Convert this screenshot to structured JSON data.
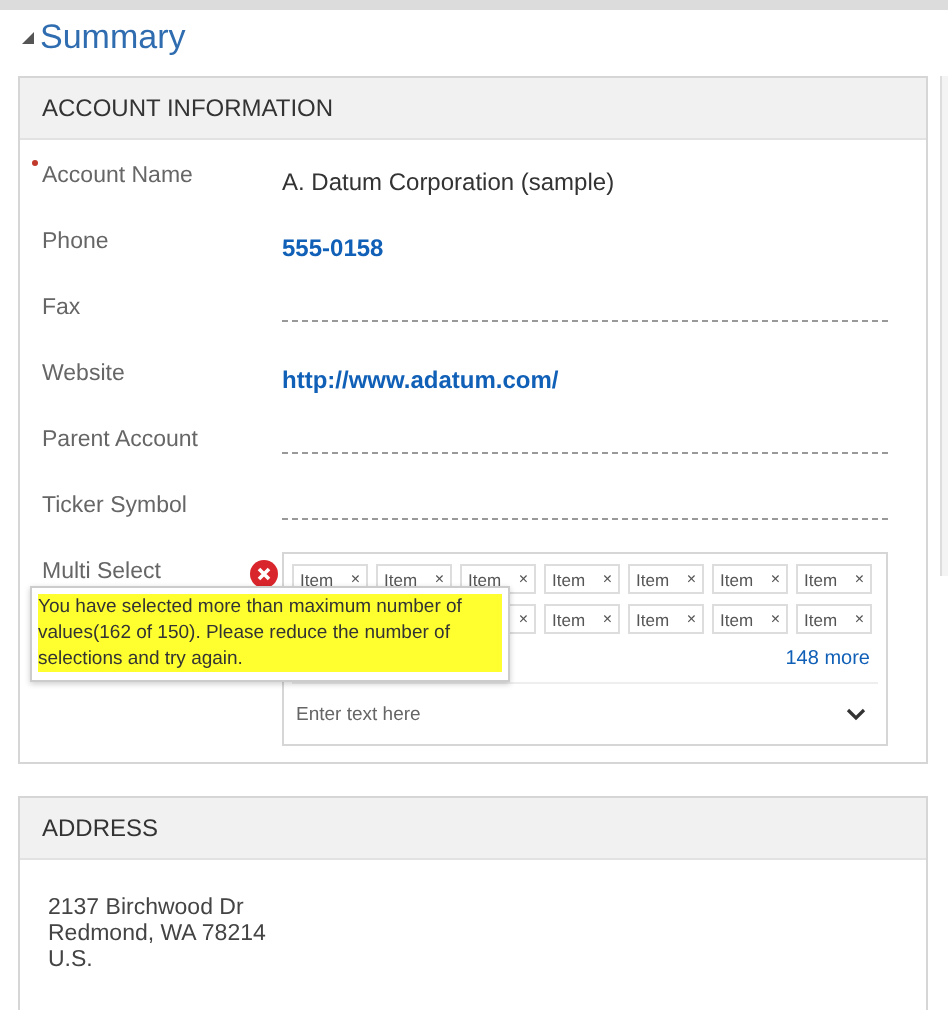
{
  "summary": {
    "title": "Summary",
    "expanded": true
  },
  "account_information": {
    "title": "ACCOUNT INFORMATION",
    "fields": [
      {
        "kind": "text",
        "label": "Account Name",
        "required": true,
        "value": "A. Datum Corporation (sample)"
      },
      {
        "kind": "link",
        "label": "Phone",
        "required": false,
        "value": "555-0158"
      },
      {
        "kind": "empty",
        "label": "Fax",
        "required": false
      },
      {
        "kind": "link",
        "label": "Website",
        "required": false,
        "value": "http://www.adatum.com/"
      },
      {
        "kind": "empty",
        "label": "Parent Account",
        "required": false
      },
      {
        "kind": "empty",
        "label": "Ticker Symbol",
        "required": false
      },
      {
        "kind": "multiselect",
        "label": "Multi Select",
        "required": false,
        "error": true,
        "token_rows": [
          [
            {
              "label": "Item"
            },
            {
              "label": "Item"
            },
            {
              "label": "Item"
            },
            {
              "label": "Item"
            },
            {
              "label": "Item"
            },
            {
              "label": "Item"
            },
            {
              "label": "Item"
            }
          ],
          [
            {
              "partly_hidden": true
            },
            {
              "label": "Item"
            },
            {
              "label": "Item"
            },
            {
              "label": "Item"
            },
            {
              "label": "Item"
            }
          ]
        ],
        "remove_glyph": "×",
        "more": "148 more",
        "placeholder": "Enter text here",
        "error_message": "You have selected more than maximum number of values(162 of 150). Please reduce the number of selections and try again."
      }
    ]
  },
  "address": {
    "title": "ADDRESS",
    "lines": [
      "2137 Birchwood Dr",
      "Redmond, WA 78214",
      "U.S."
    ]
  }
}
